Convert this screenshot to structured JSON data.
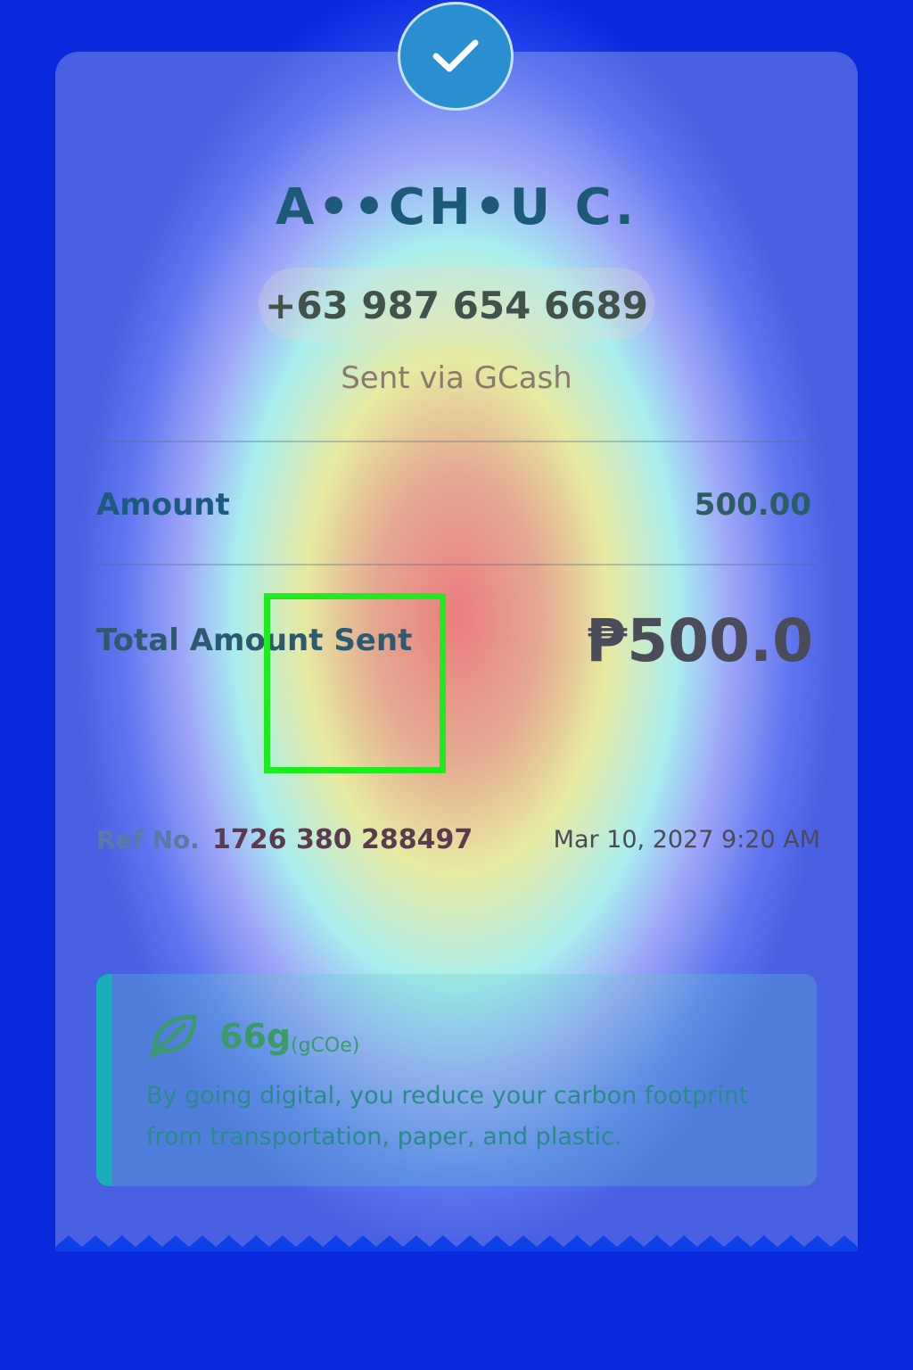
{
  "recipient": {
    "name": "A••CH•U C.",
    "phone": "+63 987 654 6689",
    "channel": "Sent via GCash"
  },
  "details": {
    "amount_label": "Amount",
    "amount_value": "500.00",
    "total_label": "Total Amount Sent",
    "total_value": "₱500.0"
  },
  "reference": {
    "label": "Ref No.",
    "number": "1726 380 288497",
    "datetime": "Mar 10, 2027 9:20 AM"
  },
  "carbon": {
    "icon": "leaf-icon",
    "grams": "66g",
    "unit": "(gCOe)",
    "message": "By going digital, you reduce your carbon footprint from transportation, paper, and plastic."
  },
  "icons": {
    "success": "check-icon"
  },
  "colors": {
    "highlight": "#1eea1e",
    "check_circle": "#2a8fd0",
    "carbon_accent": "#19aeb8"
  }
}
